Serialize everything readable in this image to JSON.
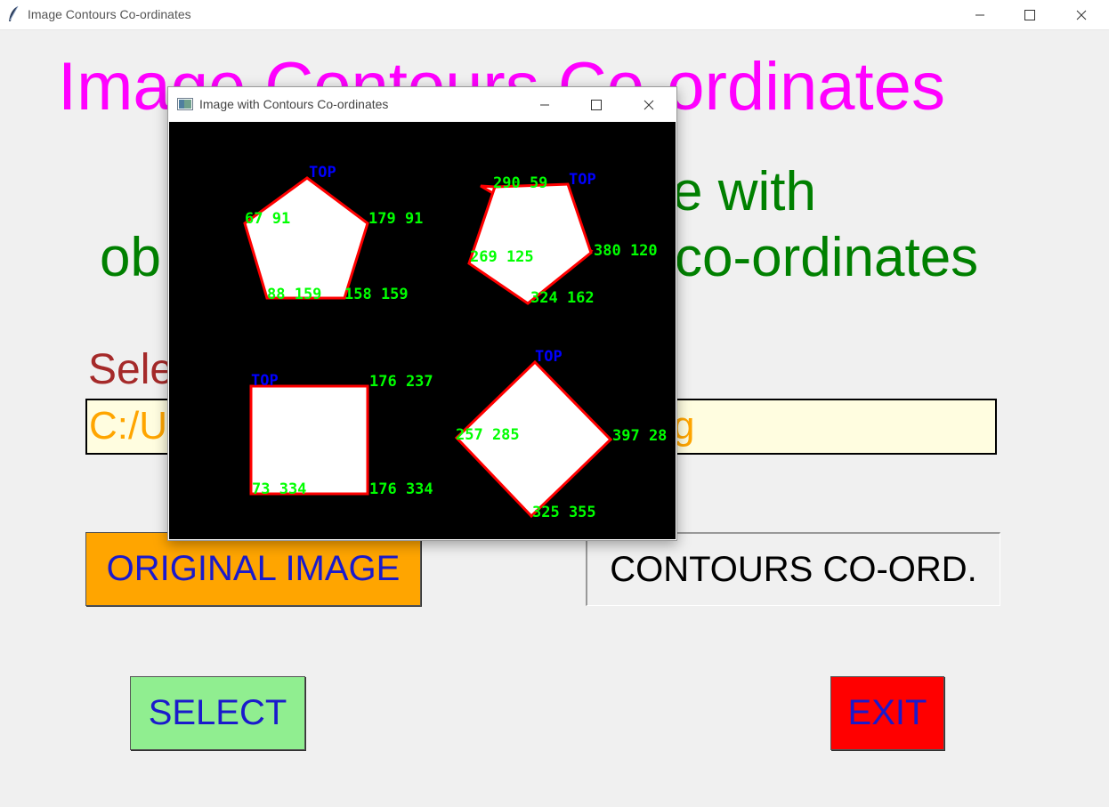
{
  "window": {
    "title": "Image Contours Co-ordinates",
    "controls": [
      "minimize-icon",
      "maximize-icon",
      "close-icon"
    ]
  },
  "main": {
    "heading": "Image Contours Co-ordinates",
    "subtitle_line1_visible": "e with",
    "subtitle_line2_left_visible": "ob",
    "subtitle_line2_right_visible": "co-ordinates",
    "select_label_visible": "Sele",
    "path_value_left_visible": "C:/U",
    "path_value_right_visible": "g",
    "buttons": {
      "original_image": "ORIGINAL IMAGE",
      "contours_coord": "CONTOURS CO-ORD.",
      "select": "SELECT",
      "exit": "EXIT"
    }
  },
  "popup": {
    "title": "Image with Contours Co-ordinates",
    "canvas_background": "#000000",
    "shape_fill": "#ffffff",
    "contour_color": "#ff0000",
    "coord_label_color": "#00ff00",
    "top_label_color": "#0000ff",
    "shapes": [
      {
        "name": "pentagon-1",
        "top_label": "TOP",
        "labels": [
          "67 91",
          "179 91",
          "88 159",
          "158 159"
        ]
      },
      {
        "name": "pentagon-2",
        "top_label": "TOP",
        "labels": [
          "290 59",
          "269 125",
          "380 120",
          "324 162"
        ]
      },
      {
        "name": "square",
        "top_label": "TOP",
        "labels": [
          "176 237",
          "73 334",
          "176 334"
        ]
      },
      {
        "name": "diamond",
        "top_label": "TOP",
        "labels": [
          "257 285",
          "397 28",
          "325 355"
        ]
      }
    ]
  },
  "colors": {
    "heading": "#ff00ff",
    "subtitle": "#008000",
    "select_label": "#a52a2a",
    "path_text": "#ffa500",
    "path_background": "#fffde0",
    "original_button": "#ffa500",
    "select_button": "#90ee90",
    "exit_button": "#ff0000",
    "button_text": "#1a1acc"
  }
}
